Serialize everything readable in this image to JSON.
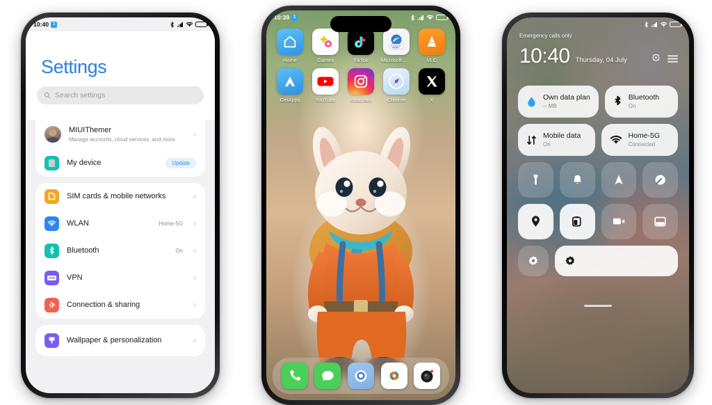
{
  "scene": {
    "background_color": "#ffffff",
    "phones": [
      "settings",
      "home-screen",
      "control-center"
    ]
  },
  "left_phone": {
    "name": "settings-phone",
    "status_bar": {
      "time": "10:40",
      "sim_badge": "1",
      "icons": [
        "bluetooth-icon",
        "signal-icon",
        "wifi-icon",
        "battery-icon"
      ]
    },
    "title": "Settings",
    "search": {
      "placeholder": "Search settings",
      "icon": "search-icon"
    },
    "account": {
      "name": "MIUIThemer",
      "subtitle": "Manage accounts, cloud services, and more",
      "chevron": "›"
    },
    "device": {
      "label": "My device",
      "badge": "Update",
      "badge_color": "#3b8ae2"
    },
    "group_network": [
      {
        "label": "SIM cards & mobile networks",
        "value": "",
        "icon": "sim-card-icon",
        "icon_color": "#f5a623",
        "chevron": "›"
      },
      {
        "label": "WLAN",
        "value": "Home-5G",
        "icon": "wifi-icon",
        "icon_color": "#2e86f0",
        "chevron": "›"
      },
      {
        "label": "Bluetooth",
        "value": "On",
        "icon": "bluetooth-icon",
        "icon_color": "#13c1b0",
        "chevron": "›"
      },
      {
        "label": "VPN",
        "value": "",
        "icon": "vpn-icon",
        "icon_color": "#7b5cf0",
        "chevron": "›"
      },
      {
        "label": "Connection & sharing",
        "value": "",
        "icon": "connection-sharing-icon",
        "icon_color": "#ef6250",
        "chevron": "›"
      }
    ],
    "group_personalization": [
      {
        "label": "Wallpaper & personalization",
        "value": "",
        "icon": "wallpaper-icon",
        "icon_color": "#7b5cf0",
        "chevron": "›"
      }
    ]
  },
  "middle_phone": {
    "name": "home-screen-phone",
    "status_bar": {
      "time": "10:39",
      "sim_badge": "1",
      "icons": [
        "bluetooth-icon",
        "signal-icon",
        "wifi-icon",
        "battery-icon"
      ]
    },
    "wallpaper_subject": "cartoon rabbit character with backpack",
    "apps_row1": [
      {
        "label": "Home",
        "icon": "home-app-icon"
      },
      {
        "label": "Games",
        "icon": "games-app-icon"
      },
      {
        "label": "TikTok",
        "icon": "tiktok-app-icon"
      },
      {
        "label": "Microsoft SwiftK...",
        "icon": "swiftkey-app-icon"
      },
      {
        "label": "VLC",
        "icon": "vlc-app-icon"
      }
    ],
    "apps_row2": [
      {
        "label": "GetApps",
        "icon": "getapps-app-icon"
      },
      {
        "label": "YouTube",
        "icon": "youtube-app-icon"
      },
      {
        "label": "Instagram",
        "icon": "instagram-app-icon"
      },
      {
        "label": "Chrome",
        "icon": "chrome-app-icon"
      },
      {
        "label": "X",
        "icon": "x-app-icon"
      }
    ],
    "dock": [
      {
        "label": "Phone",
        "icon": "phone-app-icon"
      },
      {
        "label": "Messages",
        "icon": "messages-app-icon"
      },
      {
        "label": "Settings",
        "icon": "settings-app-icon"
      },
      {
        "label": "Photos",
        "icon": "photos-app-icon"
      },
      {
        "label": "Camera",
        "icon": "camera-app-icon"
      }
    ]
  },
  "right_phone": {
    "name": "control-center-phone",
    "status_bar": {
      "carrier": "Emergency calls only",
      "icons": [
        "bluetooth-icon",
        "signal-icon",
        "wifi-icon",
        "battery-icon"
      ]
    },
    "clock": "10:40",
    "date": "Thursday, 04 July",
    "header_icons": [
      {
        "name": "settings-gear-icon"
      },
      {
        "name": "menu-hamburger-icon"
      }
    ],
    "big_tiles": [
      {
        "title": "Own data plan",
        "subtitle": "-- MB",
        "icon": "data-drop-icon",
        "state": "on"
      },
      {
        "title": "Bluetooth",
        "subtitle": "On",
        "icon": "bluetooth-icon",
        "state": "on"
      },
      {
        "title": "Mobile data",
        "subtitle": "On",
        "icon": "mobile-data-icon",
        "state": "on"
      },
      {
        "title": "Home-5G",
        "subtitle": "Connected",
        "icon": "wifi-icon",
        "state": "on"
      }
    ],
    "toggles_row1": [
      {
        "name": "flashlight-toggle",
        "icon": "flashlight-icon",
        "state": "off"
      },
      {
        "name": "silent-toggle",
        "icon": "bell-silent-icon",
        "state": "off"
      },
      {
        "name": "location-toggle",
        "icon": "navigation-arrow-icon",
        "state": "off"
      },
      {
        "name": "dark-mode-toggle",
        "icon": "contrast-circle-icon",
        "state": "off"
      }
    ],
    "toggles_row2": [
      {
        "name": "gps-toggle",
        "icon": "location-pin-icon",
        "state": "on"
      },
      {
        "name": "battery-saver-toggle",
        "icon": "battery-saver-icon",
        "state": "on"
      },
      {
        "name": "screen-recorder-toggle",
        "icon": "video-record-icon",
        "state": "off"
      },
      {
        "name": "split-screen-toggle",
        "icon": "split-screen-icon",
        "state": "off"
      }
    ],
    "bottom_row": [
      {
        "name": "theme-toggle-small",
        "icon": "flower-badge-icon",
        "state": "off"
      },
      {
        "name": "brightness-slider",
        "icon": "flower-badge-icon",
        "state": "on"
      }
    ]
  }
}
